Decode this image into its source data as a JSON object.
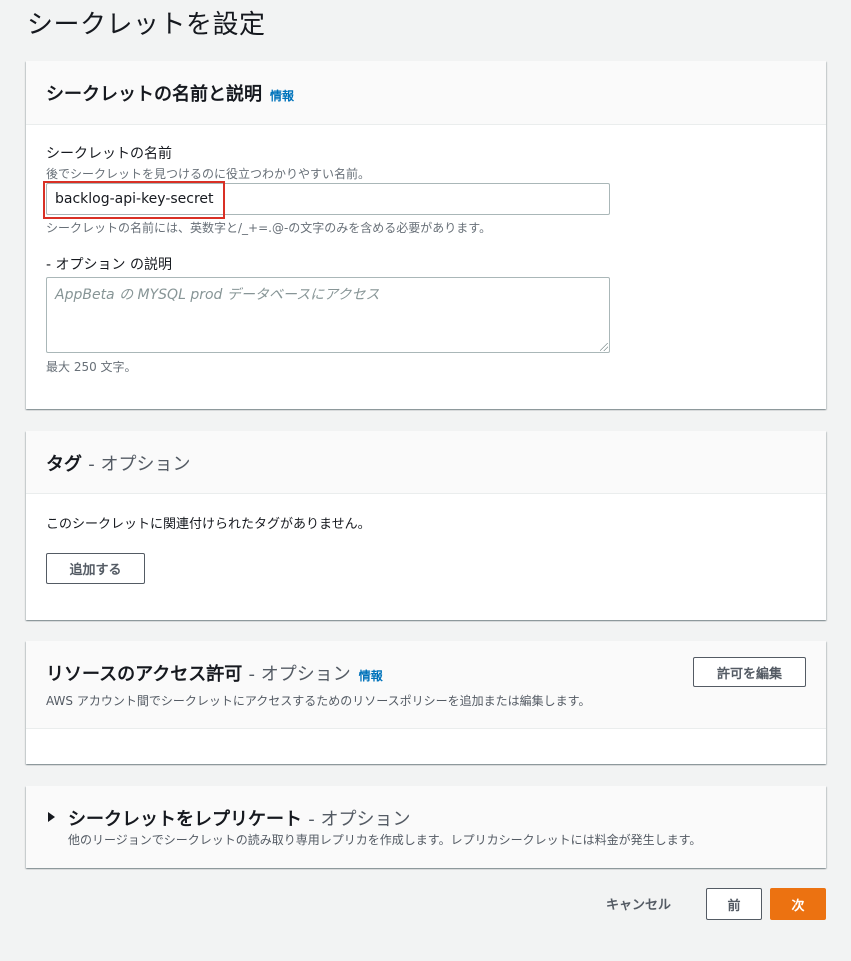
{
  "page": {
    "title": "シークレットを設定"
  },
  "name_section": {
    "title": "シークレットの名前と説明",
    "info_link": "情報",
    "name_label": "シークレットの名前",
    "name_description": "後でシークレットを見つけるのに役立つわかりやすい名前。",
    "name_value": "backlog-api-key-secret",
    "name_constraint": "シークレットの名前には、英数字と/_+=.@-の文字のみを含める必要があります。",
    "desc_label": "- オプション の説明",
    "desc_placeholder": "AppBeta の MYSQL prod データベースにアクセス",
    "desc_constraint": "最大 250 文字。"
  },
  "tags_section": {
    "title": "タグ",
    "optional_suffix": "- オプション",
    "empty_message": "このシークレットに関連付けられたタグがありません。",
    "add_button": "追加する"
  },
  "resource_section": {
    "title": "リソースのアクセス許可",
    "optional_suffix": "- オプション",
    "info_link": "情報",
    "description": "AWS アカウント間でシークレットにアクセスするためのリソースポリシーを追加または編集します。",
    "edit_button": "許可を編集"
  },
  "replicate_section": {
    "title": "シークレットをレプリケート",
    "optional_suffix": "- オプション",
    "description": "他のリージョンでシークレットの読み取り専用レプリカを作成します。レプリカシークレットには料金が発生します。"
  },
  "footer": {
    "cancel": "キャンセル",
    "previous": "前",
    "next": "次"
  },
  "colors": {
    "primary": "#ec7211",
    "link": "#0073bb",
    "highlight": "#d93025"
  }
}
